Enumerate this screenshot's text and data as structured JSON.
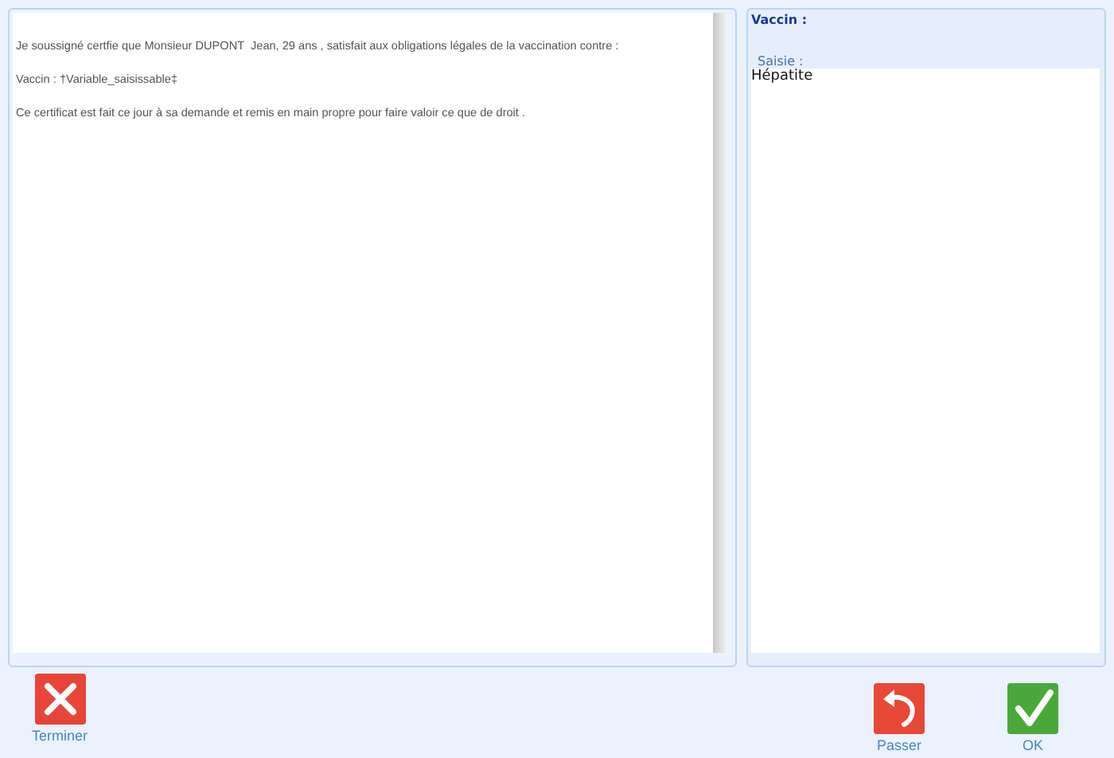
{
  "document": {
    "paragraphs": [
      "Je soussigné certfie que Monsieur DUPONT  Jean, 29 ans , satisfait aux obligations légales de la vaccination contre :",
      "Vaccin : †Variable_saisissable‡",
      "Ce certificat est fait ce jour à sa demande et remis en main propre pour faire valoir ce que de droit ."
    ]
  },
  "entry": {
    "title": "Vaccin :",
    "label": "Saisie :",
    "value": "Hépatite"
  },
  "buttons": [
    {
      "kind": "cancel",
      "label": "Terminer"
    },
    {
      "kind": "skip",
      "label": "Passer"
    },
    {
      "kind": "ok",
      "label": "OK"
    }
  ]
}
